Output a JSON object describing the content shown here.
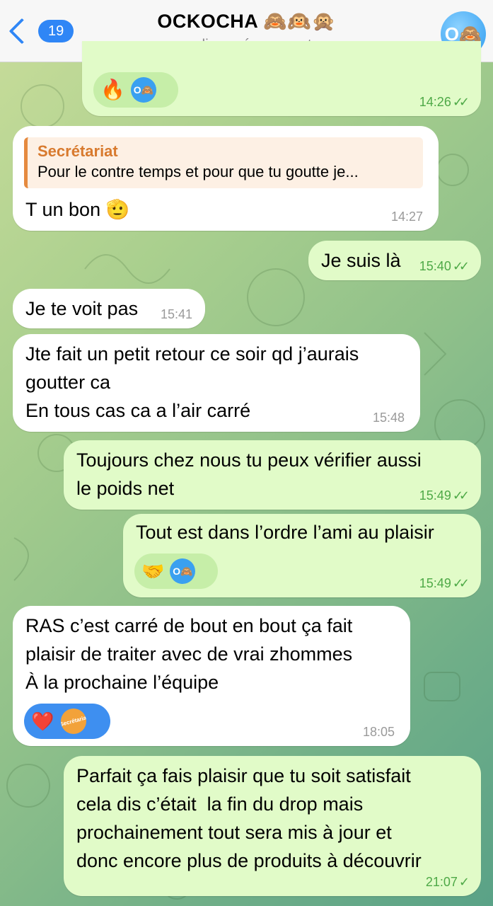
{
  "header": {
    "back_count": "19",
    "title": "OCKOCHA 🙈🙉🙊",
    "subtitle": "en ligne récemment",
    "avatar_text": "O🙈"
  },
  "messages": [
    {
      "side": "out",
      "reaction_emoji": "🔥",
      "reaction_avatar": "O🙈",
      "time": "14:26",
      "read": "✓✓"
    },
    {
      "side": "in",
      "reply_name": "Secrétariat",
      "reply_text": "Pour le contre temps et pour que tu goutte je...",
      "text": "T un bon 🫡",
      "time": "14:27"
    },
    {
      "side": "out",
      "text": "Je suis là",
      "time": "15:40",
      "read": "✓✓"
    },
    {
      "side": "in",
      "text": "Je te voit pas",
      "time": "15:41"
    },
    {
      "side": "in",
      "text": "Jte fait un petit retour ce soir qd j’aurais\ngoutter ca\nEn tous cas ca a l’air carré",
      "time": "15:48"
    },
    {
      "side": "out",
      "text": "Toujours chez nous tu peux vérifier aussi\nle poids net",
      "time": "15:49",
      "read": "✓✓"
    },
    {
      "side": "out",
      "text": "Tout est dans l’ordre l’ami au plaisir",
      "reaction_emoji": "🤝",
      "reaction_avatar": "O🙈",
      "time": "15:49",
      "read": "✓✓"
    },
    {
      "side": "in",
      "text": "RAS c’est carré de bout en bout ça fait\nplaisir de traiter avec de vrai zhommes\nÀ la prochaine l’équipe",
      "reaction_emoji": "❤️",
      "reaction_avatar": "Secrétariat",
      "time": "18:05"
    },
    {
      "side": "out",
      "text": "Parfait ça fais plaisir que tu soit satisfait\ncela dis c’était  la fin du drop mais\nprochainement tout sera mis à jour et\ndonc encore plus de produits à découvrir",
      "time": "21:07",
      "read": "✓"
    }
  ]
}
